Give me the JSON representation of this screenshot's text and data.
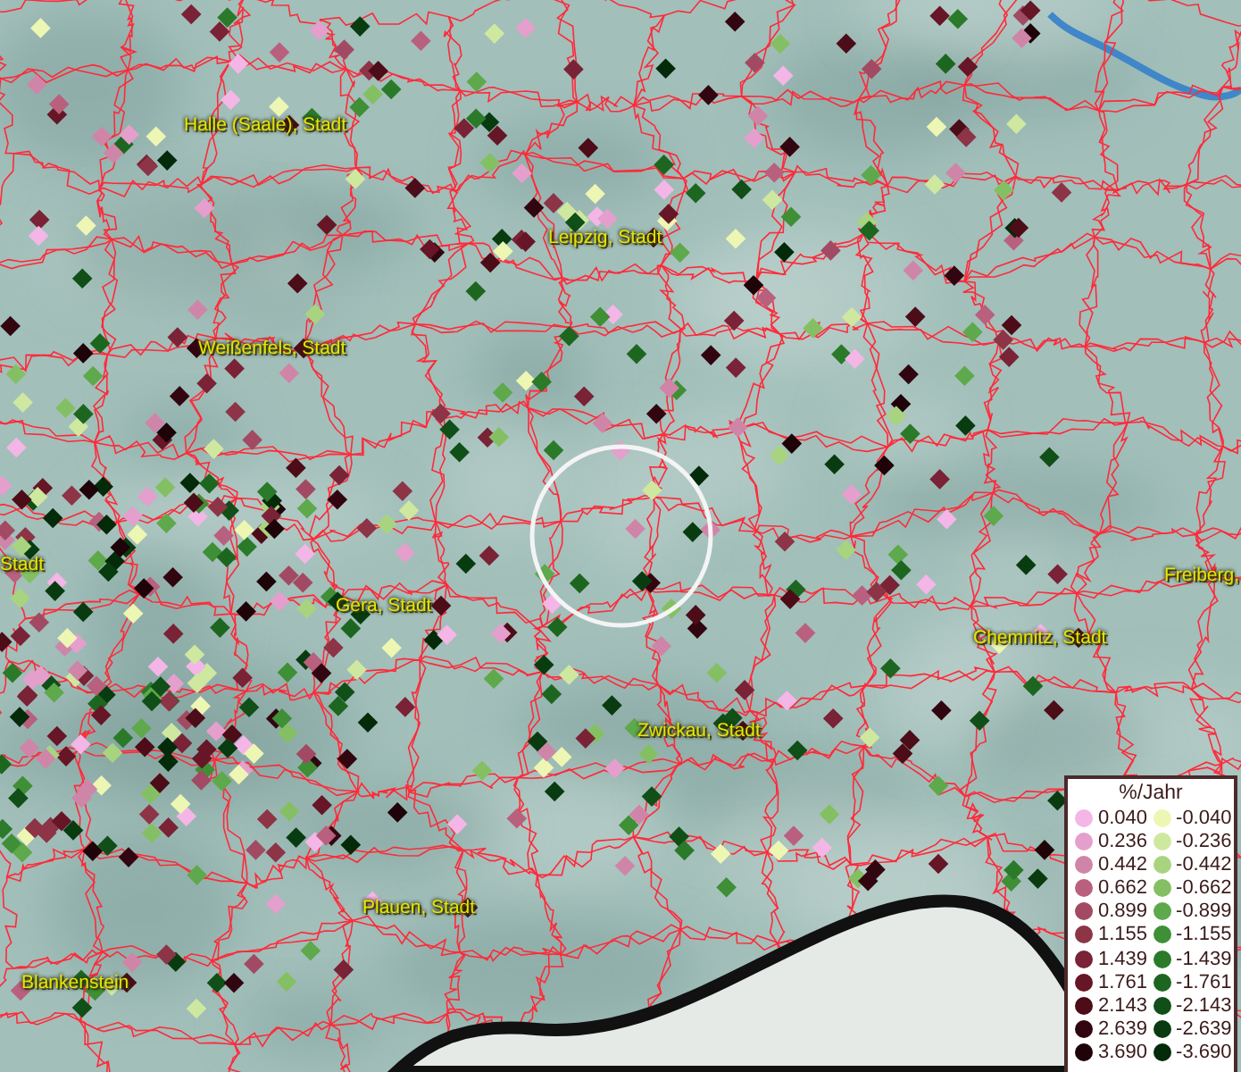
{
  "map": {
    "places": [
      {
        "name": "Halle (Saale), Stadt"
      },
      {
        "name": "Leipzig, Stadt"
      },
      {
        "name": "Weißenfels, Stadt"
      },
      {
        "name": "Stadt"
      },
      {
        "name": "Gera, Stadt"
      },
      {
        "name": "Freiberg,"
      },
      {
        "name": "Chemnitz, Stadt"
      },
      {
        "name": "Zwickau, Stadt"
      },
      {
        "name": "Plauen, Stadt"
      },
      {
        "name": "Blankenstein"
      }
    ]
  },
  "legend": {
    "title": "%/Jahr",
    "positive": [
      {
        "value": "0.040",
        "color": "#f4b6e6"
      },
      {
        "value": "0.236",
        "color": "#e59fcc"
      },
      {
        "value": "0.442",
        "color": "#cf85a8"
      },
      {
        "value": "0.662",
        "color": "#b9607f"
      },
      {
        "value": "0.899",
        "color": "#a24a63"
      },
      {
        "value": "1.155",
        "color": "#8d3447"
      },
      {
        "value": "1.439",
        "color": "#7a2236"
      },
      {
        "value": "1.761",
        "color": "#661626"
      },
      {
        "value": "2.143",
        "color": "#4c0c18"
      },
      {
        "value": "2.639",
        "color": "#320610"
      },
      {
        "value": "3.690",
        "color": "#1e0308"
      }
    ],
    "negative": [
      {
        "value": "-0.040",
        "color": "#eef6b4"
      },
      {
        "value": "-0.236",
        "color": "#cfe8a0"
      },
      {
        "value": "-0.442",
        "color": "#a9d47f"
      },
      {
        "value": "-0.662",
        "color": "#84c063"
      },
      {
        "value": "-0.899",
        "color": "#5ea94b"
      },
      {
        "value": "-1.155",
        "color": "#3e8f36"
      },
      {
        "value": "-1.439",
        "color": "#2a7a2a"
      },
      {
        "value": "-1.761",
        "color": "#1d6620"
      },
      {
        "value": "-2.143",
        "color": "#104f17"
      },
      {
        "value": "-2.639",
        "color": "#083c10"
      },
      {
        "value": "-3.690",
        "color": "#032a09"
      }
    ]
  }
}
